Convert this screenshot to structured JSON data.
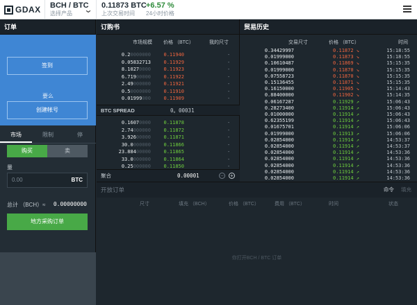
{
  "topbar": {
    "logo": "GDAX",
    "pair": "BCH / BTC",
    "pair_sub": "选择产品",
    "last_price": "0.11873 BTC",
    "last_price_label": "上次交易时间",
    "change": "+6.57 %",
    "change_label": "24小时价格"
  },
  "orders_panel": {
    "title": "订单",
    "signin": "签到",
    "or": "要么",
    "create_account": "创建帐号",
    "tabs": [
      "市场",
      "限制",
      "停"
    ],
    "buy": "购买",
    "sell": "卖",
    "amount_label": "量",
    "amount_placeholder": "0.00",
    "amount_unit": "BTC",
    "total_label": "总计 （BCH）≈",
    "total_value": "0.00000000",
    "place_order": "地方采购订单"
  },
  "order_book": {
    "title": "订购书",
    "col_size": "市场规模",
    "col_price": "价格 （BTC）",
    "col_mine": "我的尺寸",
    "asks": [
      {
        "size": "0.2",
        "zeros": "0000000",
        "price": "0.11940",
        "mine": "-"
      },
      {
        "size": "0.05832713",
        "zeros": "",
        "price": "0.11929",
        "mine": "-"
      },
      {
        "size": "8.1027",
        "zeros": "0000",
        "price": "0.11923",
        "mine": "-"
      },
      {
        "size": "6.719",
        "zeros": "00000",
        "price": "0.11922",
        "mine": "-"
      },
      {
        "size": "2.49",
        "zeros": "000000",
        "price": "0.11921",
        "mine": "-"
      },
      {
        "size": "0.5",
        "zeros": "0000000",
        "price": "0.11910",
        "mine": "-"
      },
      {
        "size": "0.01999",
        "zeros": "000",
        "price": "0.11909",
        "mine": "-"
      }
    ],
    "spread_label": "BTC SPREAD",
    "spread_value": "0。00031",
    "bids": [
      {
        "size": "0.1607",
        "zeros": "0000",
        "price": "0.11878",
        "mine": "-"
      },
      {
        "size": "2.74",
        "zeros": "000000",
        "price": "0.11872",
        "mine": "-"
      },
      {
        "size": "3.926",
        "zeros": "00000",
        "price": "0.11871",
        "mine": "-"
      },
      {
        "size": "30.0",
        "zeros": "000000",
        "price": "0.11866",
        "mine": "-"
      },
      {
        "size": "23.884",
        "zeros": "00000",
        "price": "0.11865",
        "mine": "-"
      },
      {
        "size": "33.0",
        "zeros": "000000",
        "price": "0.11864",
        "mine": "-"
      },
      {
        "size": "0.25",
        "zeros": "000000",
        "price": "0.11850",
        "mine": "-"
      }
    ],
    "aggregation_label": "聚合",
    "aggregation_value": "0.00001"
  },
  "trade_history": {
    "title": "贸易历史",
    "col_size": "交易尺寸",
    "col_price": "价格 （BTC）",
    "col_time": "时间",
    "rows": [
      {
        "size": "0.34429997",
        "zeros": "",
        "price": "0.11872",
        "side": "down",
        "time": "15:18:55"
      },
      {
        "size": "0.01999000",
        "zeros": "",
        "price": "0.11873",
        "side": "down",
        "time": "15:18:55"
      },
      {
        "size": "0.10610487",
        "zeros": "",
        "price": "0.11869",
        "side": "down",
        "time": "15:15:35"
      },
      {
        "size": "0.01999000",
        "zeros": "",
        "price": "0.11870",
        "side": "down",
        "time": "15:15:35"
      },
      {
        "size": "0.07558723",
        "zeros": "",
        "price": "0.11870",
        "side": "down",
        "time": "15:15:35"
      },
      {
        "size": "0.15136455",
        "zeros": "",
        "price": "0.11871",
        "side": "down",
        "time": "15:15:35"
      },
      {
        "size": "0.16150000",
        "zeros": "",
        "price": "0.11905",
        "side": "down",
        "time": "15:14:43"
      },
      {
        "size": "0.88400000",
        "zeros": "",
        "price": "0.11902",
        "side": "down",
        "time": "15:14:35"
      },
      {
        "size": "0.06167287",
        "zeros": "",
        "price": "0.11929",
        "side": "up",
        "time": "15:06:43"
      },
      {
        "size": "0.28273400",
        "zeros": "",
        "price": "0.11914",
        "side": "up",
        "time": "15:06:43"
      },
      {
        "size": "0.01000000",
        "zeros": "",
        "price": "0.11914",
        "side": "up",
        "time": "15:06:43"
      },
      {
        "size": "0.62355199",
        "zeros": "",
        "price": "0.11914",
        "side": "up",
        "time": "15:06:43"
      },
      {
        "size": "0.01675701",
        "zeros": "",
        "price": "0.11914",
        "side": "up",
        "time": "15:06:06"
      },
      {
        "size": "0.01999000",
        "zeros": "",
        "price": "0.11913",
        "side": "up",
        "time": "15:06:06"
      },
      {
        "size": "0.02854000",
        "zeros": "",
        "price": "0.11914",
        "side": "up",
        "time": "14:53:37"
      },
      {
        "size": "0.02854000",
        "zeros": "",
        "price": "0.11914",
        "side": "up",
        "time": "14:53:37"
      },
      {
        "size": "0.02854000",
        "zeros": "",
        "price": "0.11914",
        "side": "up",
        "time": "14:53:36"
      },
      {
        "size": "0.02854000",
        "zeros": "",
        "price": "0.11914",
        "side": "up",
        "time": "14:53:36"
      },
      {
        "size": "0.02854000",
        "zeros": "",
        "price": "0.11914",
        "side": "up",
        "time": "14:53:36"
      },
      {
        "size": "0.02854000",
        "zeros": "",
        "price": "0.11914",
        "side": "up",
        "time": "14:53:36"
      },
      {
        "size": "0.02854000",
        "zeros": "",
        "price": "0.11914",
        "side": "up",
        "time": "14:53:36"
      }
    ]
  },
  "open_orders": {
    "title": "开放订单",
    "tabs": [
      "命令",
      "填充"
    ],
    "columns": [
      "尺寸",
      "填充 （BCH）",
      "价格 （BTC）",
      "费用 （BTC）",
      "时间",
      "状态"
    ],
    "empty_text": "你打开BCH / BTC 订单"
  }
}
